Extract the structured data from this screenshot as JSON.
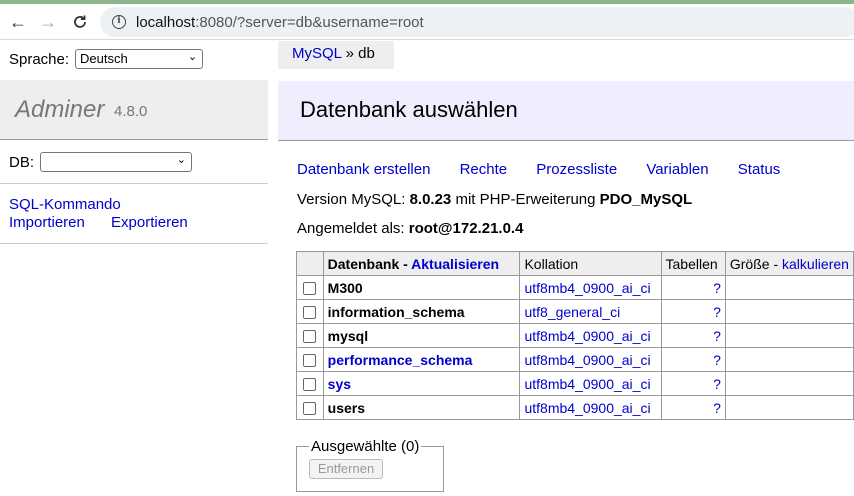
{
  "browser": {
    "url_host": "localhost",
    "url_rest": ":8080/?server=db&username=root",
    "back_icon": "←",
    "forward_icon": "→",
    "reload_icon": "C"
  },
  "menu": {
    "language_label": "Sprache:",
    "language_value": "Deutsch",
    "brand_name": "Adminer",
    "brand_version": "4.8.0",
    "db_label": "DB:",
    "db_value": "",
    "sql_command": "SQL-Kommando",
    "import": "Importieren",
    "export": "Exportieren"
  },
  "breadcrumb": {
    "root": "MySQL",
    "separator": "»",
    "current": "db"
  },
  "content": {
    "title": "Datenbank auswählen",
    "actions": [
      "Datenbank erstellen",
      "Rechte",
      "Prozessliste",
      "Variablen",
      "Status"
    ],
    "version_label": "Version MySQL:",
    "version_value": "8.0.23",
    "version_ext_label": "mit PHP-Erweiterung",
    "version_ext_value": "PDO_MySQL",
    "logged_label": "Angemeldet als:",
    "logged_value": "root@172.21.0.4"
  },
  "table": {
    "header_db": "Datenbank",
    "header_dash": " - ",
    "header_refresh": "Aktualisieren",
    "header_collation": "Kollation",
    "header_tables": "Tabellen",
    "header_size": "Größe",
    "header_size_dash": " - ",
    "header_calc": "kalkulieren",
    "rows": [
      {
        "name": "M300",
        "collation": "utf8mb4_0900_ai_ci",
        "tables": "?",
        "link": false
      },
      {
        "name": "information_schema",
        "collation": "utf8_general_ci",
        "tables": "?",
        "link": false
      },
      {
        "name": "mysql",
        "collation": "utf8mb4_0900_ai_ci",
        "tables": "?",
        "link": false
      },
      {
        "name": "performance_schema",
        "collation": "utf8mb4_0900_ai_ci",
        "tables": "?",
        "link": true
      },
      {
        "name": "sys",
        "collation": "utf8mb4_0900_ai_ci",
        "tables": "?",
        "link": true
      },
      {
        "name": "users",
        "collation": "utf8mb4_0900_ai_ci",
        "tables": "?",
        "link": false
      }
    ]
  },
  "selection": {
    "legend": "Ausgewählte (0)",
    "remove_label": "Entfernen"
  }
}
